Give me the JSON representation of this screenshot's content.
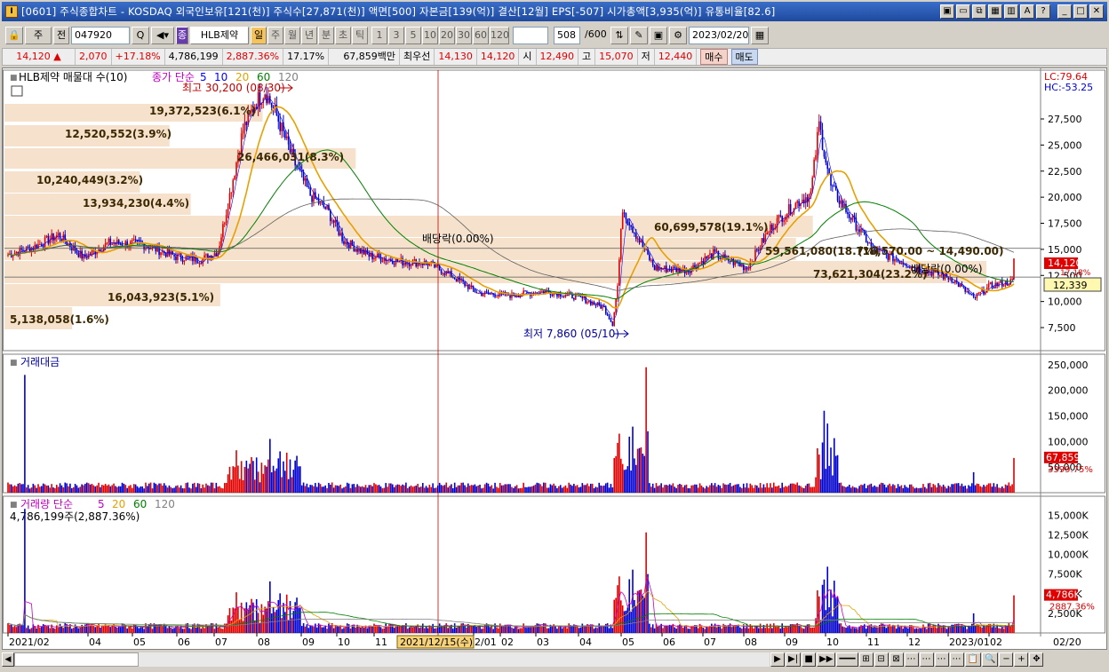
{
  "window": {
    "app_icon": "I",
    "title": "[0601] 주식종합차트 - KOSDAQ 외국인보유[121(천)] 주식수[27,871(천)] 액면[500] 자본금[139(억)] 결산[12월] EPS[-507] 시가총액[3,935(억)] 유통비율[82.6]",
    "title_buttons": [
      "window-icon",
      "minimize-all-icon",
      "restore-icon",
      "chart-icon",
      "lock-icon",
      "font-icon",
      "help-icon",
      "minimize-icon",
      "maximize-icon",
      "close-icon"
    ],
    "title_glyphs": [
      "▣",
      "▭",
      "⧉",
      "▦",
      "▥",
      "A",
      "?",
      "_",
      "□",
      "✕"
    ]
  },
  "toolbar": {
    "lock": "🔒",
    "type_select": "주",
    "prev_label": "전",
    "code_value": "047920",
    "search_glyph": "Q",
    "sound_glyph": "◀▾",
    "stock_badge": "종",
    "stock_name": "HLB제약",
    "periods": [
      "일",
      "주",
      "월",
      "년",
      "분",
      "초",
      "틱"
    ],
    "active_period": "일",
    "intervals": [
      "1",
      "3",
      "5",
      "10",
      "20",
      "30",
      "60",
      "120"
    ],
    "count_value": "508",
    "count_total": "/600",
    "date_value": "2023/02/20"
  },
  "quote": {
    "price": "14,120 ▲",
    "change": "2,070",
    "change_pct": "+17.18%",
    "volume": "4,786,199",
    "volume_ratio": "2,887.36%",
    "turnover": "17.17%",
    "amount": "67,859백만",
    "best_label": "최우선",
    "best_ask": "14,130",
    "best_bid": "14,120",
    "open_label": "시",
    "open": "12,490",
    "high_label": "고",
    "high": "15,070",
    "low_label": "저",
    "low": "12,440",
    "buy_label": "매수",
    "sell_label": "매도"
  },
  "price_panel": {
    "legend_name": "HLB제약 매물대 수(10)",
    "legend_ma_title": "종가 단순",
    "legend_ma": [
      "5",
      "10",
      "20",
      "60",
      "120"
    ],
    "legend_ma_colors": [
      "#0000ff",
      "#0000ff",
      "#e8a000",
      "#008000",
      "#808080"
    ],
    "lc": "LC:79.64",
    "hc": "HC:-53.25",
    "high_note": "최고 30,200 (08/30)",
    "low_note": "최저 7,860 (05/10)",
    "dividend_note": "배당락(0.00%)",
    "dividend_note2": "배당락(0.00%)",
    "range_note": "(16,570.00 ~ 14,490.00)",
    "current_price_tag": "14,120",
    "ref_price_tag": "12,339",
    "sub_tag": "17.18%",
    "y_ticks": [
      "27,500",
      "25,000",
      "22,500",
      "20,000",
      "17,500",
      "15,000",
      "12,500",
      "10,000",
      "7,500"
    ],
    "volume_profile": [
      {
        "label": "19,372,523(6.1%)"
      },
      {
        "label": "12,520,552(3.9%)"
      },
      {
        "label": "26,466,031(8.3%)"
      },
      {
        "label": "10,240,449(3.2%)"
      },
      {
        "label": "13,934,230(4.4%)"
      },
      {
        "label": "60,699,578(19.1%)"
      },
      {
        "label": "59,561,080(18.7%)"
      },
      {
        "label": "73,621,304(23.2%)"
      },
      {
        "label": "16,043,923(5.1%)"
      },
      {
        "label": "5,138,058(1.6%)"
      }
    ]
  },
  "amount_panel": {
    "title": "거래대금",
    "y_ticks": [
      "250,000",
      "200,000",
      "150,000",
      "100,000",
      "50,000"
    ],
    "current_tag": "67,859",
    "ratio_tag": "3399.75%"
  },
  "volume_panel": {
    "title": "거래량 단순",
    "ma": [
      "5",
      "20",
      "60",
      "120"
    ],
    "ma_colors": [
      "#c000c0",
      "#e8a000",
      "#008000",
      "#808080"
    ],
    "info": "4,786,199주(2,887.36%)",
    "y_ticks": [
      "15,000K",
      "12,500K",
      "10,000K",
      "7,500K",
      "5,000K",
      "2,500K"
    ],
    "current_tag": "4,786K",
    "ratio_tag": "2887.36%"
  },
  "x_axis": {
    "labels": [
      "2021/02",
      "04",
      "05",
      "06",
      "07",
      "08",
      "09",
      "10",
      "11",
      "2/01",
      "02",
      "03",
      "04",
      "05",
      "06",
      "07",
      "08",
      "09",
      "10",
      "11",
      "12",
      "2023/01",
      "02"
    ],
    "cursor_date": "2021/12/15(수)",
    "right_label": "02/20"
  },
  "scroll": {
    "controls": [
      "▶",
      "▶|",
      "■",
      "▶▶",
      "━━━",
      "⊞",
      "⊟",
      "⊠",
      "⋯",
      "⋯",
      "⋯",
      "⋯",
      "📋",
      "🔍",
      "−",
      "+",
      "✥"
    ]
  },
  "colors": {
    "up": "#e00000",
    "down": "#0000d0",
    "profile": "#f6e2cc"
  }
}
